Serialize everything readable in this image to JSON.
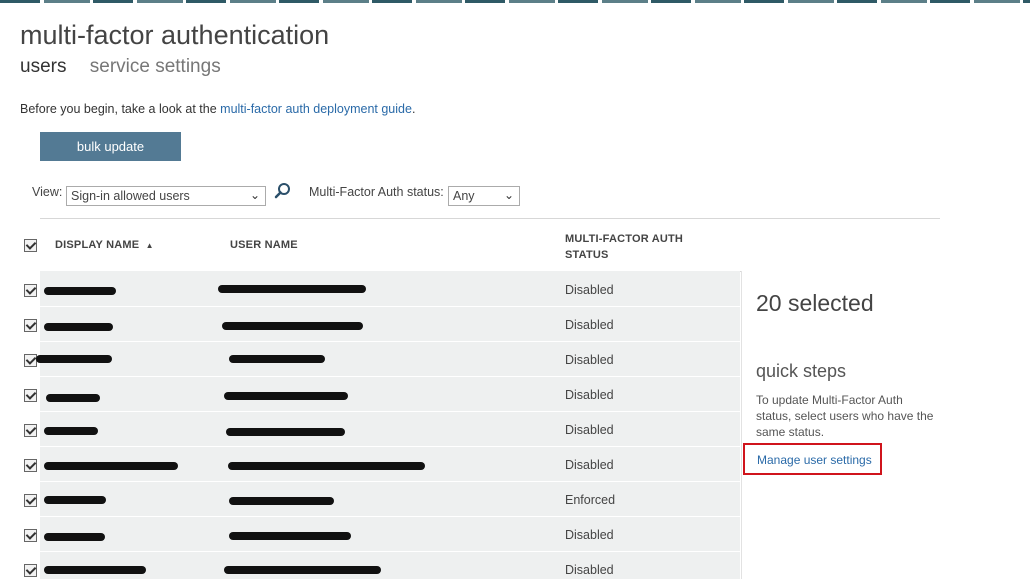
{
  "page": {
    "title": "multi-factor authentication",
    "tabs": [
      {
        "label": "users",
        "active": true
      },
      {
        "label": "service settings",
        "active": false
      }
    ],
    "intro_prefix": "Before you begin, take a look at the",
    "intro_link": "multi-factor auth deployment guide",
    "intro_suffix": "."
  },
  "toolbar": {
    "bulk_update": "bulk update",
    "view_label": "View:",
    "view_value": "Sign-in allowed users",
    "status_label": "Multi-Factor Auth status:",
    "status_value": "Any"
  },
  "table": {
    "columns": {
      "display_name": "DISPLAY NAME",
      "user_name": "USER NAME",
      "status_line1": "MULTI-FACTOR AUTH",
      "status_line2": "STATUS"
    },
    "rows": [
      {
        "status": "Disabled",
        "checked": true
      },
      {
        "status": "Disabled",
        "checked": true
      },
      {
        "status": "Disabled",
        "checked": true
      },
      {
        "status": "Disabled",
        "checked": true
      },
      {
        "status": "Disabled",
        "checked": true
      },
      {
        "status": "Disabled",
        "checked": true
      },
      {
        "status": "Enforced",
        "checked": true
      },
      {
        "status": "Disabled",
        "checked": true
      },
      {
        "status": "Disabled",
        "checked": true
      }
    ]
  },
  "panel": {
    "selected_count": "20 selected",
    "quick_steps_title": "quick steps",
    "quick_steps_text": "To update Multi-Factor Auth status, select users who have the same status.",
    "manage_link": "Manage user settings"
  },
  "colors": {
    "bulk_button": "#537a94",
    "link": "#2a6aa8",
    "highlight_box": "#d0141c"
  }
}
